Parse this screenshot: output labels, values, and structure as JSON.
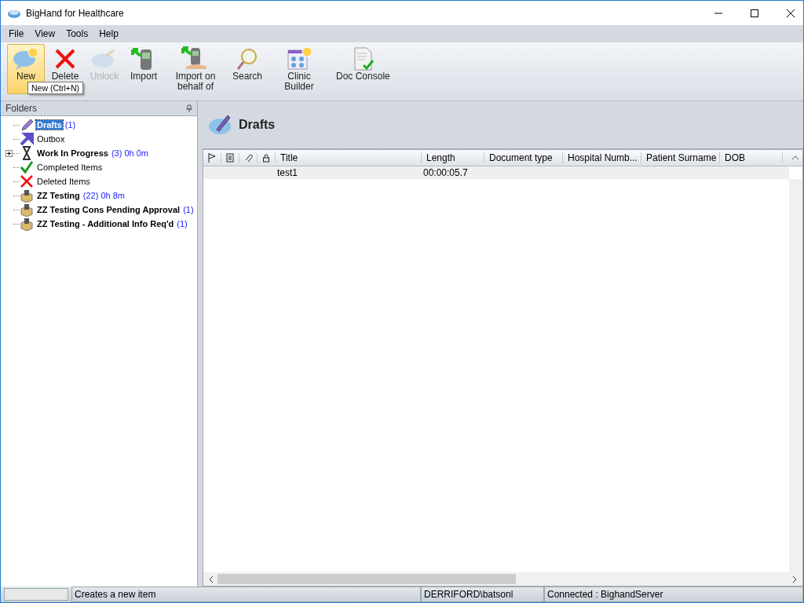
{
  "window": {
    "title": "BigHand for Healthcare"
  },
  "menu": [
    "File",
    "View",
    "Tools",
    "Help"
  ],
  "toolbar": [
    {
      "label": "New",
      "hover": true,
      "disabled": false
    },
    {
      "label": "Delete",
      "hover": false,
      "disabled": false
    },
    {
      "label": "Unlock",
      "hover": false,
      "disabled": true
    },
    {
      "label": "Import",
      "hover": false,
      "disabled": false
    },
    {
      "label": "Import on behalf of",
      "hover": false,
      "disabled": false
    },
    {
      "label": "Search",
      "hover": false,
      "disabled": false
    },
    {
      "label": "Clinic Builder",
      "hover": false,
      "disabled": false
    },
    {
      "label": "Doc Console",
      "hover": false,
      "disabled": false
    }
  ],
  "tooltip": "New (Ctrl+N)",
  "folders": {
    "title": "Folders",
    "items": [
      {
        "name": "Drafts",
        "count": "(1)",
        "selected": true,
        "bold": true
      },
      {
        "name": "Outbox",
        "selected": false,
        "bold": false
      },
      {
        "name": "Work In Progress",
        "count": "(3) 0h 0m",
        "selected": false,
        "bold": true,
        "expanded": false
      },
      {
        "name": "Completed Items",
        "selected": false,
        "bold": false
      },
      {
        "name": "Deleted Items",
        "selected": false,
        "bold": false
      },
      {
        "name": "ZZ Testing",
        "count": "(22) 0h 8m",
        "selected": false,
        "bold": true
      },
      {
        "name": "ZZ Testing Cons Pending Approval",
        "count": "(1)",
        "selected": false,
        "bold": true
      },
      {
        "name": "ZZ Testing - Additional Info Req'd",
        "count": "(1)",
        "selected": false,
        "bold": true
      }
    ]
  },
  "content": {
    "title": "Drafts",
    "columns": [
      "Title",
      "Length",
      "Document type",
      "Hospital Numb...",
      "Patient Surname",
      "DOB"
    ],
    "rows": [
      {
        "cells": [
          "test1",
          "00:00:05.7",
          "",
          "",
          "",
          ""
        ],
        "selected": true
      }
    ]
  },
  "status_bar": [
    "Creates a new item",
    "DERRIFORD\\batsonl",
    "Connected : BighandServer"
  ]
}
